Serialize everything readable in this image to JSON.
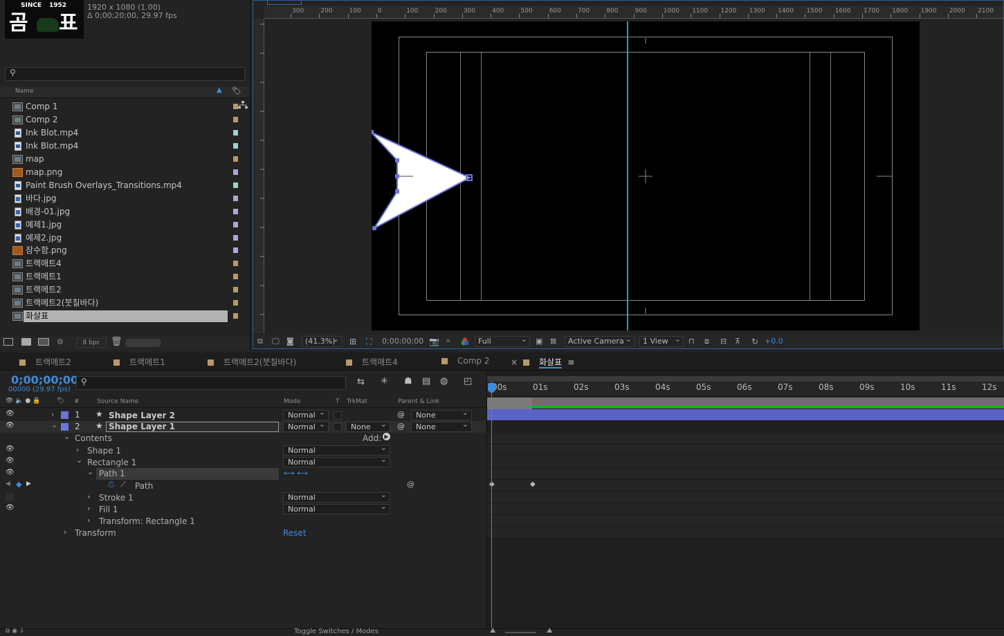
{
  "thumbnail": {
    "since": "SINCE",
    "year": "1952",
    "glyph_left": "곰",
    "glyph_right": "표"
  },
  "project": {
    "dimensions": "1920 x 1080 (1.00)",
    "duration": "Δ 0;00;20;00, 29.97 fps",
    "column_name": "Name",
    "items": [
      {
        "name": "Comp 1",
        "type": "comp",
        "label_color": "#b7996b"
      },
      {
        "name": "Comp 2",
        "type": "comp",
        "label_color": "#b7996b"
      },
      {
        "name": "Ink Blot.mp4",
        "type": "vid",
        "label_color": "#9ed3cf"
      },
      {
        "name": "Ink Blot.mp4",
        "type": "vid",
        "label_color": "#9ed3cf"
      },
      {
        "name": "map",
        "type": "comp",
        "label_color": "#b7996b"
      },
      {
        "name": "map.png",
        "type": "img",
        "label_color": "#a9a9d6"
      },
      {
        "name": "Paint Brush Overlays_Transitions.mp4",
        "type": "vid",
        "label_color": "#9ed3cf"
      },
      {
        "name": "바다.jpg",
        "type": "jpg",
        "label_color": "#a9a9d6"
      },
      {
        "name": "배경-01.jpg",
        "type": "jpg",
        "label_color": "#a9a9d6"
      },
      {
        "name": "예제1.jpg",
        "type": "jpg",
        "label_color": "#a9a9d6"
      },
      {
        "name": "예제2.jpg",
        "type": "jpg",
        "label_color": "#a9a9d6"
      },
      {
        "name": "잠수함.png",
        "type": "img",
        "label_color": "#a9a9d6"
      },
      {
        "name": "트랙매트4",
        "type": "comp",
        "label_color": "#b7996b"
      },
      {
        "name": "트랙메트1",
        "type": "comp",
        "label_color": "#b7996b"
      },
      {
        "name": "트랙메트2",
        "type": "comp",
        "label_color": "#b7996b"
      },
      {
        "name": "트랙메트2(붓칠바다)",
        "type": "comp",
        "label_color": "#b7996b"
      },
      {
        "name": "화살표",
        "type": "comp",
        "label_color": "#b7996b",
        "selected": true
      }
    ],
    "bpc": "8 bpc"
  },
  "viewer": {
    "ruler_labels": [
      "300",
      "200",
      "100",
      "0",
      "100",
      "200",
      "300",
      "400",
      "500",
      "600",
      "700",
      "800",
      "900",
      "1000",
      "1100",
      "1200",
      "1300",
      "1400",
      "1500",
      "1600",
      "1700",
      "1800",
      "1900",
      "2000",
      "2100"
    ],
    "zoom": "(41.3%)",
    "timecode": "0;00;00;00",
    "resolution": "Full",
    "camera": "Active Camera",
    "views": "1 View",
    "exposure": "+0.0"
  },
  "timeline": {
    "tabs": [
      "트랙메트2",
      "트랙메트1",
      "트랙메트2(붓칠바다)",
      "트랙매트4",
      "Comp 2",
      "화살표"
    ],
    "active_tab": "화살표",
    "timecode": "0;00;00;00",
    "frames": "00000 (29.97 fps)",
    "headers": {
      "source_name": "Source Name",
      "mode": "Mode",
      "t": "T",
      "trkmat": "TrkMat",
      "parent": "Parent & Link"
    },
    "layers": [
      {
        "num": "1",
        "name": "Shape Layer 2",
        "mode": "Normal",
        "trkmat": "",
        "parent": "None"
      },
      {
        "num": "2",
        "name": "Shape Layer 1",
        "mode": "Normal",
        "trkmat": "None",
        "parent": "None"
      }
    ],
    "props": {
      "contents": "Contents",
      "add": "Add:",
      "shape1": "Shape 1",
      "shape1_mode": "Normal",
      "rect1": "Rectangle 1",
      "rect1_mode": "Normal",
      "path1": "Path 1",
      "path": "Path",
      "stroke1": "Stroke 1",
      "stroke1_mode": "Normal",
      "fill1": "Fill 1",
      "fill1_mode": "Normal",
      "transform_rect": "Transform: Rectangle 1",
      "transform": "Transform",
      "reset": "Reset"
    },
    "time_labels": [
      "00s",
      "01s",
      "02s",
      "03s",
      "04s",
      "05s",
      "06s",
      "07s",
      "08s",
      "09s",
      "10s",
      "11s",
      "12s"
    ],
    "footer_label": "Toggle Switches / Modes"
  }
}
